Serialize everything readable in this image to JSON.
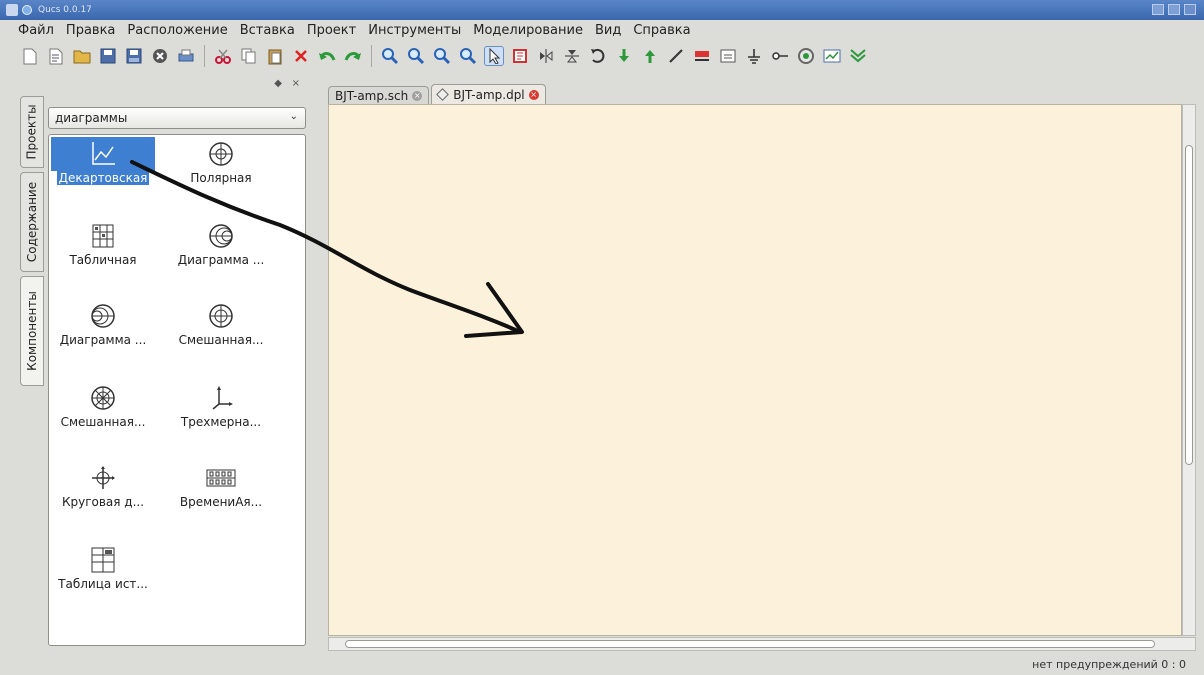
{
  "window": {
    "title": "Qucs 0.0.17"
  },
  "menu": [
    "Файл",
    "Правка",
    "Расположение",
    "Вставка",
    "Проект",
    "Инструменты",
    "Моделирование",
    "Вид",
    "Справка"
  ],
  "dock": {
    "tabs": [
      "Проекты",
      "Содержание",
      "Компоненты"
    ],
    "active_tab": "Компоненты",
    "float_glyph": "◆",
    "close_glyph": "×",
    "category": "диаграммы",
    "components": [
      {
        "label": "Декартовская",
        "icon": "cartesian-diagram-icon",
        "selected": true
      },
      {
        "label": "Полярная",
        "icon": "polar-diagram-icon"
      },
      {
        "label": "Табличная",
        "icon": "tabular-diagram-icon"
      },
      {
        "label": "Диаграмма ...",
        "icon": "smith-chart-icon"
      },
      {
        "label": "Диаграмма ...",
        "icon": "admittance-chart-icon"
      },
      {
        "label": "Смешанная...",
        "icon": "polar-smith-icon"
      },
      {
        "label": "Смешанная...",
        "icon": "smith-polar-icon"
      },
      {
        "label": "Трехмерна...",
        "icon": "3d-cartesian-icon"
      },
      {
        "label": "Круговая д...",
        "icon": "locus-curve-icon"
      },
      {
        "label": "ВремениАя...",
        "icon": "timing-diagram-icon"
      },
      {
        "label": "Таблица ист...",
        "icon": "truth-table-icon"
      }
    ]
  },
  "doc_tabs": [
    {
      "label": "BJT-amp.sch",
      "active": false
    },
    {
      "label": "BJT-amp.dpl",
      "active": true
    }
  ],
  "status": "нет предупреждений 0 : 0",
  "colors": {
    "canvas": "#fcf2dc",
    "selection": "#3f7fd1",
    "title_bar": "#3a66ae"
  }
}
